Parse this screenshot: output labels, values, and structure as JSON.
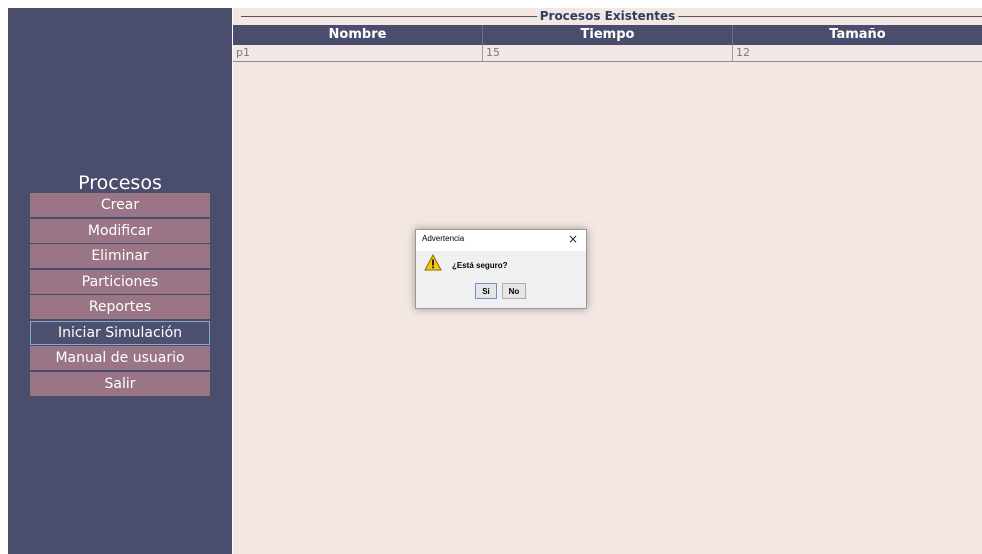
{
  "sidebar": {
    "title": "Procesos",
    "menu": [
      {
        "label": "Crear"
      },
      {
        "label": "Modificar"
      },
      {
        "label": "Eliminar"
      },
      {
        "label": "Particiones"
      },
      {
        "label": "Reportes"
      },
      {
        "label": "Iniciar Simulación"
      },
      {
        "label": "Manual de usuario"
      },
      {
        "label": "Salir"
      }
    ]
  },
  "main": {
    "group_title": "Procesos Existentes",
    "table": {
      "headers": [
        "Nombre",
        "Tiempo",
        "Tamaño"
      ],
      "rows": [
        [
          "p1",
          "15",
          "12"
        ]
      ]
    }
  },
  "dialog": {
    "title": "Advertencia",
    "close": "×",
    "icon": "warning-icon",
    "message": "¿Está seguro?",
    "buttons": {
      "yes": "Si",
      "no": "No"
    }
  },
  "colors": {
    "sidebar_bg": "#4a4d6c",
    "menu_button_bg": "#9a7585",
    "main_bg": "#f3e7e3",
    "table_header_bg": "#4a4d6c"
  }
}
